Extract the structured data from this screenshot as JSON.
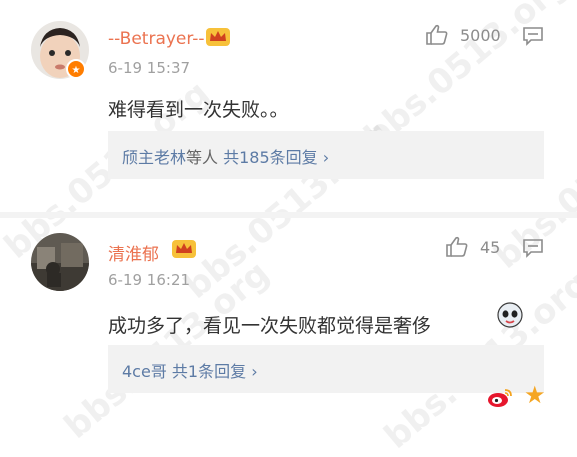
{
  "comments": [
    {
      "name": "--Betrayer--",
      "time": "6-19 15:37",
      "likes": "5000",
      "text": "难得看到一次失败。。",
      "reply_users": "颀主老林",
      "reply_connector": "等人",
      "reply_count": "共185条回复",
      "reply_arrow": "›"
    },
    {
      "name": "清淮郁",
      "time": "6-19 16:21",
      "likes": "45",
      "text": "成功多了，看见一次失败都觉得是奢侈",
      "reply_users": "4ce哥",
      "reply_count": "共1条回复",
      "reply_arrow": "›"
    }
  ],
  "watermark": "bbs.0513.org",
  "footer": {
    "star": "★"
  },
  "colors": {
    "name": "#eb7350",
    "link": "#5d7ba5",
    "accent": "#ff7d00"
  },
  "icons": [
    "thumbs-up-icon",
    "comment-icon",
    "crown-icon",
    "verified-badge-icon",
    "weibo-logo-icon",
    "star-icon",
    "emoji-icon"
  ]
}
